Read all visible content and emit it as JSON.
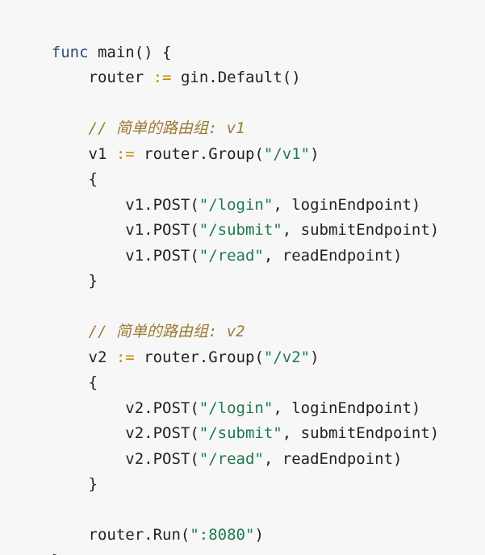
{
  "code": {
    "lines": [
      [
        {
          "text": "func",
          "kind": "kw"
        },
        {
          "text": " main() {",
          "kind": "plain"
        }
      ],
      [
        {
          "text": "    router ",
          "kind": "plain"
        },
        {
          "text": ":=",
          "kind": "op"
        },
        {
          "text": " gin.Default()",
          "kind": "plain"
        }
      ],
      [],
      [
        {
          "text": "    // 简单的路由组: v1",
          "kind": "comment"
        }
      ],
      [
        {
          "text": "    v1 ",
          "kind": "plain"
        },
        {
          "text": ":=",
          "kind": "op"
        },
        {
          "text": " router.Group(",
          "kind": "plain"
        },
        {
          "text": "\"/v1\"",
          "kind": "str"
        },
        {
          "text": ")",
          "kind": "plain"
        }
      ],
      [
        {
          "text": "    {",
          "kind": "plain"
        }
      ],
      [
        {
          "text": "        v1.POST(",
          "kind": "plain"
        },
        {
          "text": "\"/login\"",
          "kind": "str"
        },
        {
          "text": ", loginEndpoint)",
          "kind": "plain"
        }
      ],
      [
        {
          "text": "        v1.POST(",
          "kind": "plain"
        },
        {
          "text": "\"/submit\"",
          "kind": "str"
        },
        {
          "text": ", submitEndpoint)",
          "kind": "plain"
        }
      ],
      [
        {
          "text": "        v1.POST(",
          "kind": "plain"
        },
        {
          "text": "\"/read\"",
          "kind": "str"
        },
        {
          "text": ", readEndpoint)",
          "kind": "plain"
        }
      ],
      [
        {
          "text": "    }",
          "kind": "plain"
        }
      ],
      [],
      [
        {
          "text": "    // 简单的路由组: v2",
          "kind": "comment"
        }
      ],
      [
        {
          "text": "    v2 ",
          "kind": "plain"
        },
        {
          "text": ":=",
          "kind": "op"
        },
        {
          "text": " router.Group(",
          "kind": "plain"
        },
        {
          "text": "\"/v2\"",
          "kind": "str"
        },
        {
          "text": ")",
          "kind": "plain"
        }
      ],
      [
        {
          "text": "    {",
          "kind": "plain"
        }
      ],
      [
        {
          "text": "        v2.POST(",
          "kind": "plain"
        },
        {
          "text": "\"/login\"",
          "kind": "str"
        },
        {
          "text": ", loginEndpoint)",
          "kind": "plain"
        }
      ],
      [
        {
          "text": "        v2.POST(",
          "kind": "plain"
        },
        {
          "text": "\"/submit\"",
          "kind": "str"
        },
        {
          "text": ", submitEndpoint)",
          "kind": "plain"
        }
      ],
      [
        {
          "text": "        v2.POST(",
          "kind": "plain"
        },
        {
          "text": "\"/read\"",
          "kind": "str"
        },
        {
          "text": ", readEndpoint)",
          "kind": "plain"
        }
      ],
      [
        {
          "text": "    }",
          "kind": "plain"
        }
      ],
      [],
      [
        {
          "text": "    router.Run(",
          "kind": "plain"
        },
        {
          "text": "\":8080\"",
          "kind": "str"
        },
        {
          "text": ")",
          "kind": "plain"
        }
      ],
      [
        {
          "text": "}",
          "kind": "plain"
        }
      ]
    ]
  },
  "colors": {
    "background": "#f7f7f7",
    "keyword": "#2f4c7a",
    "operator": "#c28b00",
    "string": "#1f7a4d",
    "comment": "#9a7a33",
    "text": "#222222"
  }
}
